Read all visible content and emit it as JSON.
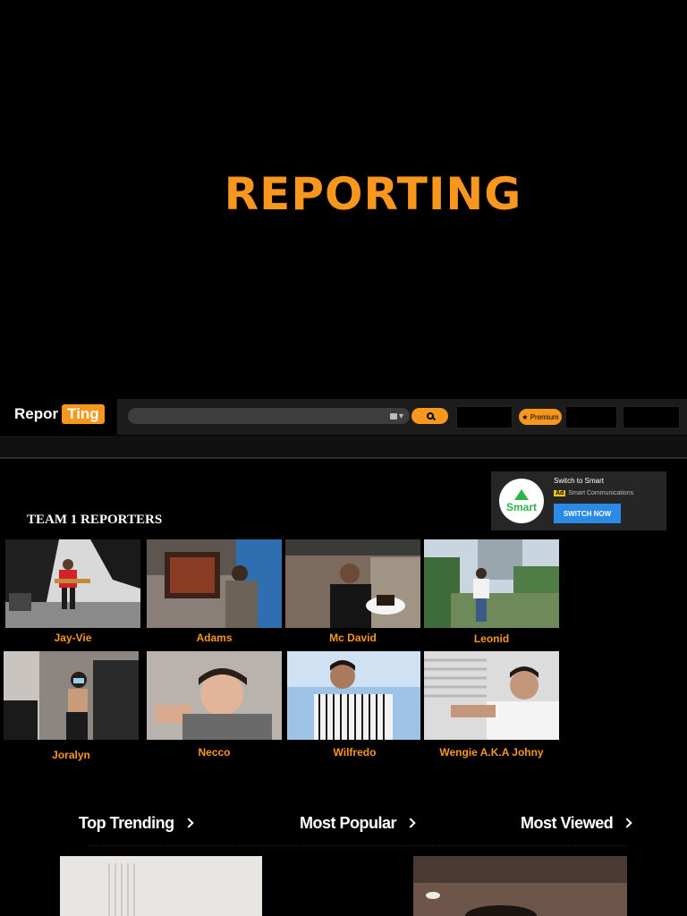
{
  "hero": {
    "title": "REPORTING"
  },
  "brand": {
    "part1": "Repor",
    "part2": "Ting"
  },
  "topbar": {
    "search_placeholder": "",
    "premium_label": "★ Premium"
  },
  "ad": {
    "logo_text": "Smart",
    "title": "Switch to Smart",
    "ad_tag": "Ad",
    "sponsor": "Smart Communications",
    "button": "SWITCH NOW"
  },
  "section": {
    "heading": "TEAM 1 REPORTERS"
  },
  "reporters": [
    {
      "name": "Jay-Vie"
    },
    {
      "name": "Adams"
    },
    {
      "name": "Mc David"
    },
    {
      "name": "Leonid"
    },
    {
      "name": "Joralyn"
    },
    {
      "name": "Necco"
    },
    {
      "name": "Wilfredo"
    },
    {
      "name": "Wengie A.K.A Johny"
    }
  ],
  "categories": [
    {
      "label": "Top Trending"
    },
    {
      "label": "Most Popular"
    },
    {
      "label": "Most Viewed"
    }
  ],
  "colors": {
    "accent": "#f7971d",
    "background": "#000000",
    "ad_button": "#2b8ae6"
  }
}
